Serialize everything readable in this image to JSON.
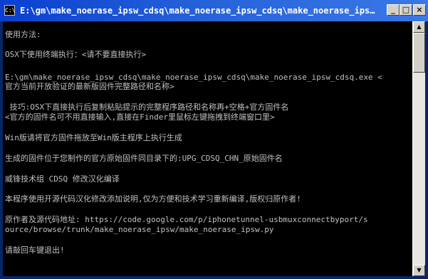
{
  "window": {
    "title": "E:\\gm\\make_noerase_ipsw_cdsq\\make_noerase_ipsw_cdsq\\make_noerase_ipsw_cdsq.exe",
    "icon_text": "C:\\",
    "buttons": {
      "minimize": "_",
      "maximize": "□",
      "close": "×"
    }
  },
  "console": {
    "lines": [
      "使用方法:",
      "OSX下使用终端执行：<请不要直接执行>",
      "E:\\gm\\make_noerase_ipsw_cdsq\\make_noerase_ipsw_cdsq\\make_noerase_ipsw_cdsq.exe <",
      "官方当前开放验证的最新版固件完整路径和名称>",
      " 技巧:OSX下直接执行后复制粘贴提示的完整程序路径和名称再+空格+官方固件名",
      "<官方的固件名可不用直接输入,直接在Finder里鼠标左键拖拽到终端窗口里>",
      "Win版请将官方固件拖放至Win版主程序上执行生成",
      "生成的固件位于您制作的官方原始固件同目录下的:UPG_CDSQ_CHN_原始固件名",
      "威锋技术组 CDSQ 修改汉化编译",
      "本程序使用开源代码汉化修改添加说明,仅为方便和技术学习重新编译,版权归原作者!",
      "原作者及源代码地址: https://code.google.com/p/iphonetunnel-usbmuxconnectbyport/s",
      "ource/browse/trunk/make_noerase_ipsw/make_noerase_ipsw.py",
      "请敲回车键退出!"
    ]
  },
  "scrollbar": {
    "up_arrow": "▲",
    "down_arrow": "▼"
  },
  "colors": {
    "title_bar": "#0a3fd0",
    "console_bg": "#000000",
    "console_text": "#c0c0c0"
  }
}
